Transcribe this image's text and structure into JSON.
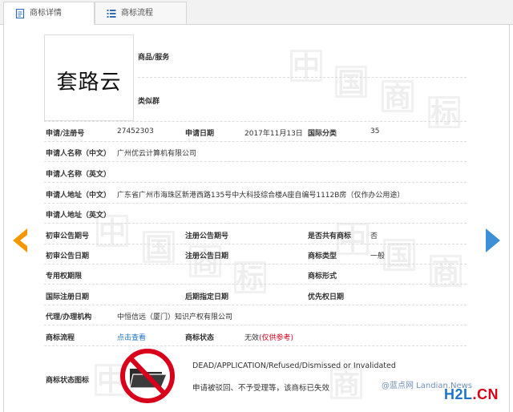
{
  "tabs": [
    {
      "label": "商标详情",
      "active": true,
      "icon": "doc-icon"
    },
    {
      "label": "商标流程",
      "active": false,
      "icon": "list-icon"
    }
  ],
  "header": {
    "logo_text": "套路云",
    "goods_label": "商品/服务",
    "similar_label": "类似群"
  },
  "fields": {
    "reg_no_label": "申请/注册号",
    "reg_no": "27452303",
    "apply_date_label": "申请日期",
    "apply_date": "2017年11月13日",
    "intl_class_label": "国际分类",
    "intl_class": "35",
    "applicant_cn_label": "申请人名称（中文）",
    "applicant_cn": "广州优云计算机有限公司",
    "applicant_en_label": "申请人名称（英文）",
    "address_cn_label": "申请人地址（中文）",
    "address_cn": "广东省广州市海珠区新港西路135号中大科技综合楼A座自编号1112B房（仅作办公用途）",
    "address_en_label": "申请人地址（英文）",
    "prelim_no_label": "初审公告期号",
    "reg_pub_no_label": "注册公告期号",
    "shared_label": "是否共有商标",
    "shared": "否",
    "prelim_date_label": "初审公告日期",
    "reg_pub_date_label": "注册公告日期",
    "type_label": "商标类型",
    "type": "一般",
    "exclusive_label": "专用权期限",
    "form_label": "商标形式",
    "intl_reg_date_label": "国际注册日期",
    "later_date_label": "后期指定日期",
    "priority_date_label": "优先权日期",
    "agent_label": "代理/办理机构",
    "agent": "中恒信远（厦门）知识产权有限公司",
    "flow_label": "商标流程",
    "flow_link": "点击查看",
    "status_label": "商标状态",
    "status": "无效",
    "status_note": "(仅供参考)",
    "status_icon_label": "商标状态图标",
    "status_en": "DEAD/APPLICATION/Refused/Dismissed or Invalidated",
    "status_cn": "申请被驳回、不予受理等，该商标已失效"
  },
  "watermark": {
    "chars": [
      "中",
      "国",
      "商",
      "标"
    ]
  },
  "credit": {
    "text": "@蓝点网 Landian.News",
    "brand_h2l": "H2L",
    "brand_cn": ".CN"
  },
  "colors": {
    "accent_blue": "#1e74c6",
    "arrow_orange": "#f39800",
    "arrow_blue": "#3d8fd6",
    "dead_red": "#d9001b"
  }
}
